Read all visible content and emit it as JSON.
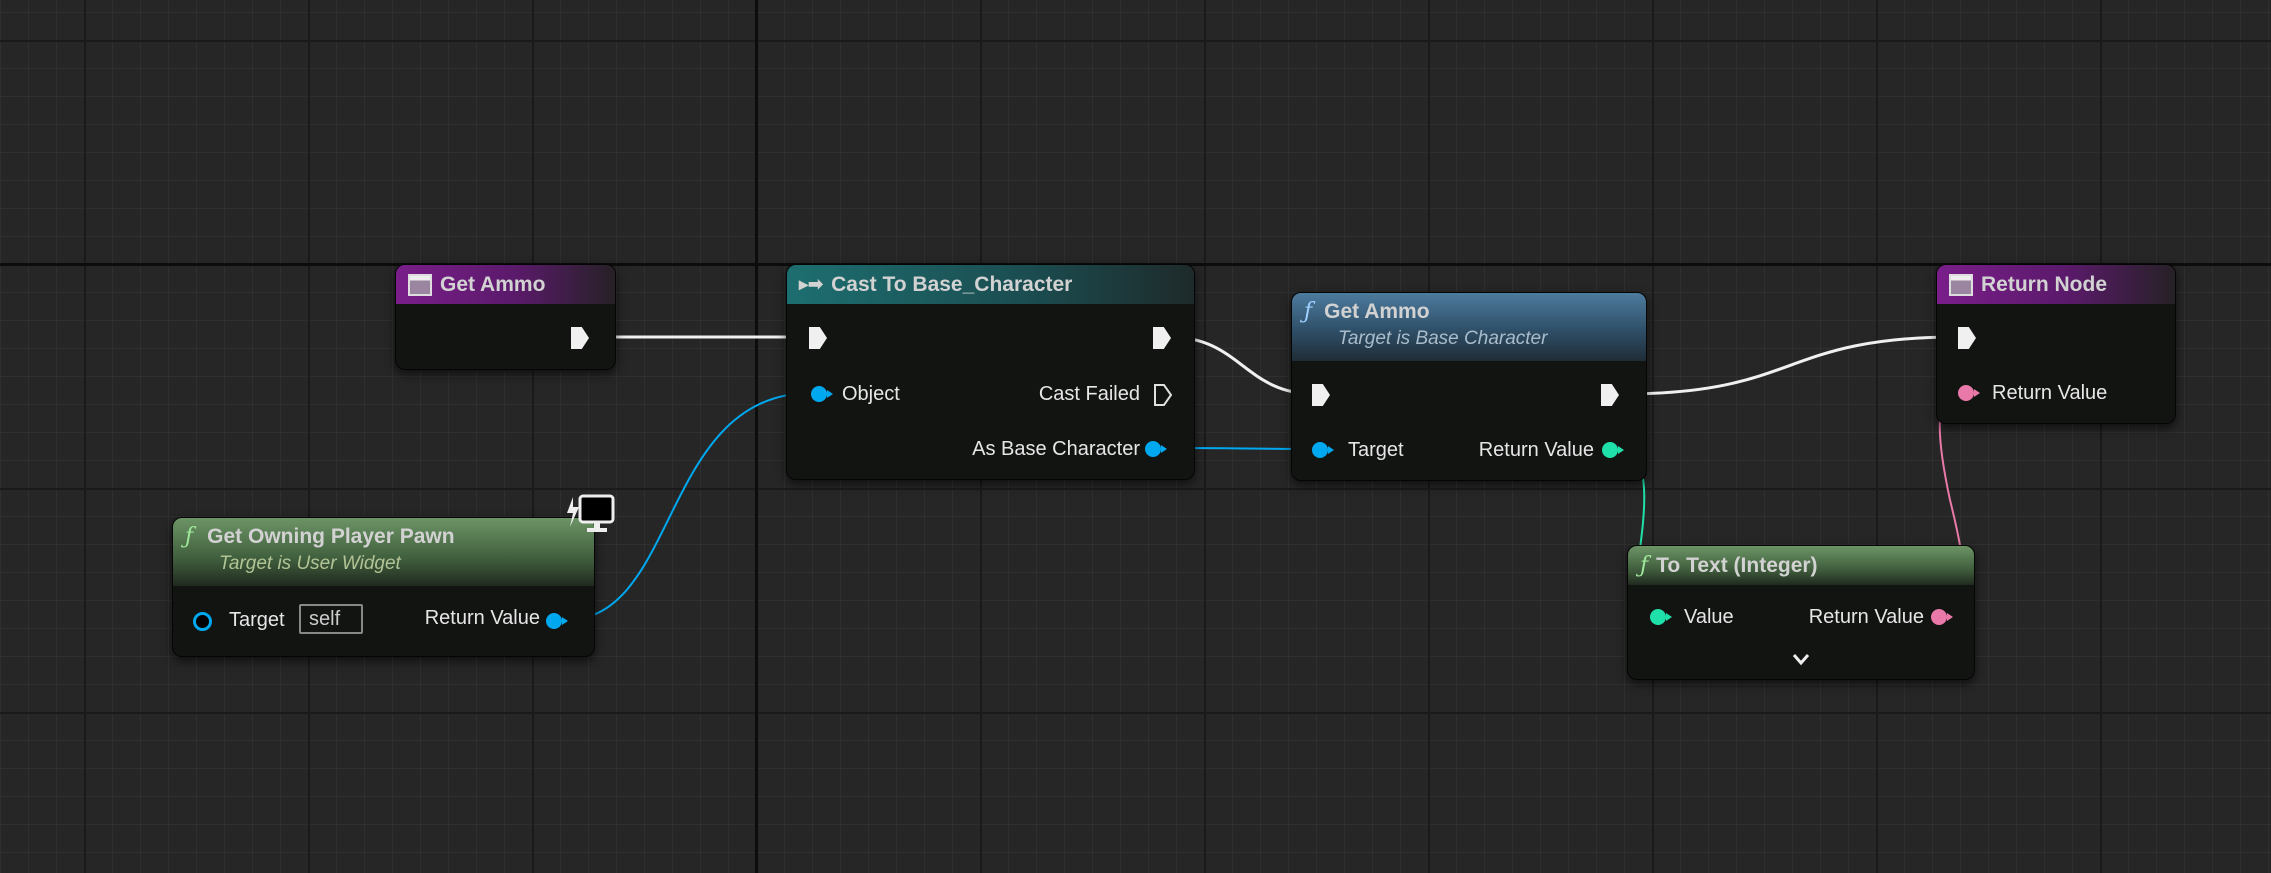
{
  "colors": {
    "exec": "#f0f0f0",
    "object": "#00a8f0",
    "integer": "#1fe0a8",
    "text": "#e879a8",
    "event_header": "#7a1e8a",
    "cast_header": "#1d6e70",
    "function_header": "#4d7b9e",
    "pure_header": "#6c9466"
  },
  "nodes": {
    "entry": {
      "title": "Get Ammo",
      "icon": "function-entry-icon"
    },
    "cast": {
      "title": "Cast To Base_Character",
      "icon": "cast-icon",
      "pins": {
        "object": "Object",
        "cast_failed": "Cast Failed",
        "as_base": "As Base Character"
      }
    },
    "get_ammo": {
      "title": "Get Ammo",
      "subtitle": "Target is Base Character",
      "icon": "function-icon",
      "pins": {
        "target": "Target",
        "return_value": "Return Value"
      }
    },
    "return_node": {
      "title": "Return Node",
      "icon": "function-result-icon",
      "pins": {
        "return_value": "Return Value"
      }
    },
    "owning_pawn": {
      "title": "Get Owning Player Pawn",
      "subtitle": "Target is User Widget",
      "icon": "function-icon",
      "badge_icon": "client-only-monitor-icon",
      "pins": {
        "target": "Target",
        "target_value": "self",
        "return_value": "Return Value"
      }
    },
    "to_text": {
      "title": "To Text (Integer)",
      "icon": "function-icon",
      "pins": {
        "value": "Value",
        "return_value": "Return Value"
      },
      "expand_icon": "chevron-down-icon"
    }
  }
}
